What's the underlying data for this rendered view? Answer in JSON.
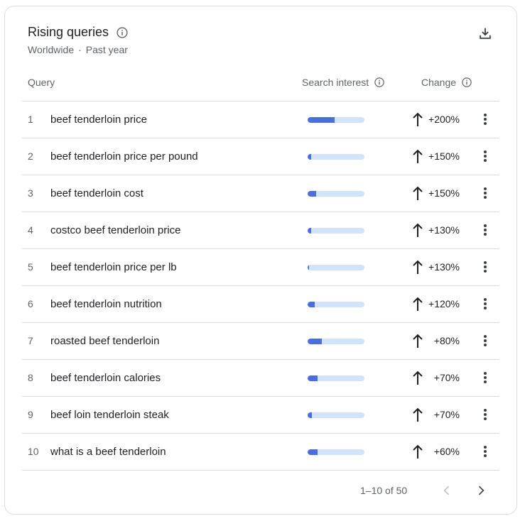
{
  "header": {
    "title": "Rising queries",
    "region": "Worldwide",
    "separator": "·",
    "period": "Past year"
  },
  "columns": {
    "query": "Query",
    "interest": "Search interest",
    "change": "Change"
  },
  "rows": [
    {
      "rank": "1",
      "query": "beef tenderloin price",
      "interest": 0.47,
      "change": "+200%"
    },
    {
      "rank": "2",
      "query": "beef tenderloin price per pound",
      "interest": 0.06,
      "change": "+150%"
    },
    {
      "rank": "3",
      "query": "beef tenderloin cost",
      "interest": 0.15,
      "change": "+150%"
    },
    {
      "rank": "4",
      "query": "costco beef tenderloin price",
      "interest": 0.06,
      "change": "+130%"
    },
    {
      "rank": "5",
      "query": "beef tenderloin price per lb",
      "interest": 0.03,
      "change": "+130%"
    },
    {
      "rank": "6",
      "query": "beef tenderloin nutrition",
      "interest": 0.13,
      "change": "+120%"
    },
    {
      "rank": "7",
      "query": "roasted beef tenderloin",
      "interest": 0.25,
      "change": "+80%"
    },
    {
      "rank": "8",
      "query": "beef tenderloin calories",
      "interest": 0.18,
      "change": "+70%"
    },
    {
      "rank": "9",
      "query": "beef loin tenderloin steak",
      "interest": 0.07,
      "change": "+70%"
    },
    {
      "rank": "10",
      "query": "what is a beef tenderloin",
      "interest": 0.18,
      "change": "+60%"
    }
  ],
  "pagination": {
    "label": "1–10 of 50"
  },
  "colors": {
    "bar_fill": "#4a6fdc",
    "bar_track": "#d2e3fc",
    "border": "#dadce0"
  },
  "icons": {
    "info": "info-icon",
    "download": "download-icon",
    "arrow": "arrow-up-icon",
    "more": "more-vert-icon",
    "prev": "chevron-left-icon",
    "next": "chevron-right-icon"
  }
}
